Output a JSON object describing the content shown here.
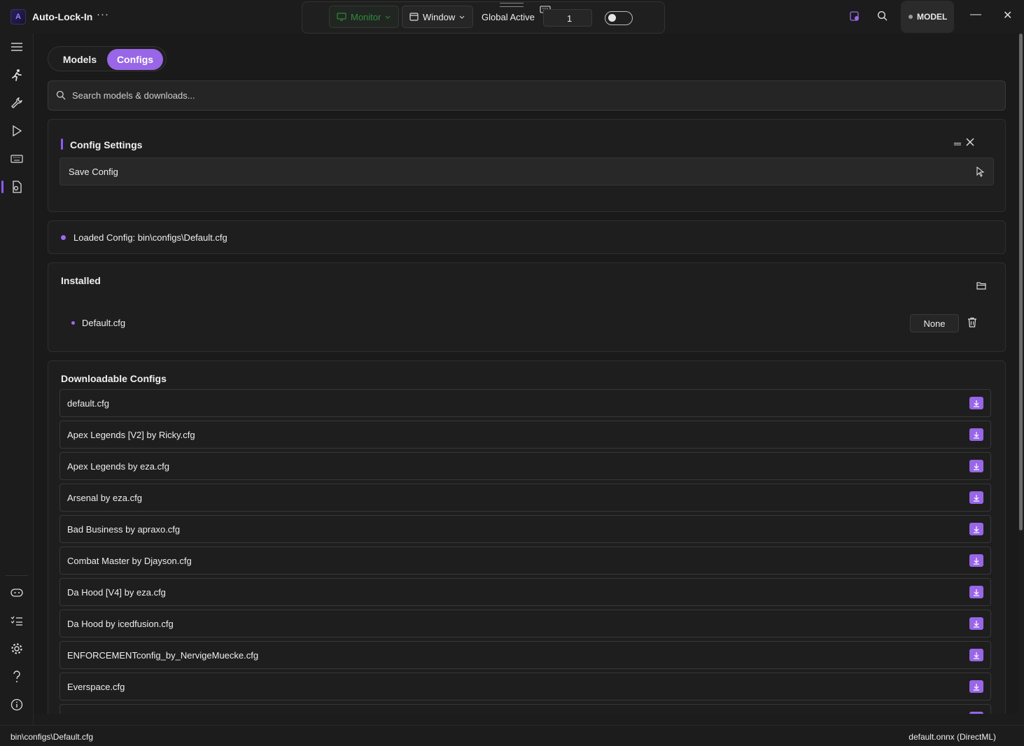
{
  "app": {
    "title": "Auto-Lock-In",
    "more": "···",
    "logo_text": "A"
  },
  "topbar": {
    "monitor_label": "Monitor",
    "window_label": "Window",
    "global_active_label": "Global Active",
    "hotkey_value": "1",
    "model_label": "MODEL"
  },
  "window_controls": {
    "minimize": "—",
    "close": "✕"
  },
  "tabs": [
    {
      "label": "Models"
    },
    {
      "label": "Configs"
    }
  ],
  "search": {
    "placeholder": "Search models & downloads..."
  },
  "config_settings": {
    "title": "Config Settings",
    "save_label": "Save Config",
    "min_label": "═"
  },
  "loaded": {
    "text": "Loaded Config: bin\\configs\\Default.cfg"
  },
  "installed": {
    "title": "Installed",
    "items": [
      {
        "name": "Default.cfg",
        "binding": "None"
      }
    ]
  },
  "downloadable": {
    "title": "Downloadable Configs",
    "items": [
      "default.cfg",
      "Apex Legends [V2] by Ricky.cfg",
      "Apex Legends by eza.cfg",
      "Arsenal by eza.cfg",
      "Bad Business by apraxo.cfg",
      "Combat Master by Djayson.cfg",
      "Da Hood [V4] by eza.cfg",
      "Da Hood by icedfusion.cfg",
      "ENFORCEMENTconfig_by_NervigeMuecke.cfg",
      "Everspace.cfg",
      ""
    ]
  },
  "statusbar": {
    "left": "bin\\configs\\Default.cfg",
    "right": "default.onnx (DirectML)"
  },
  "colors": {
    "accent": "#9866e6",
    "monitor_green": "#2e8b3e"
  },
  "icons": {
    "sidebar": [
      "menu-icon",
      "runner-icon",
      "wrench-icon",
      "play-icon",
      "keyboard-icon",
      "config-file-icon",
      "gamepad-icon",
      "checklist-icon",
      "gear-icon",
      "help-icon",
      "info-icon"
    ]
  }
}
